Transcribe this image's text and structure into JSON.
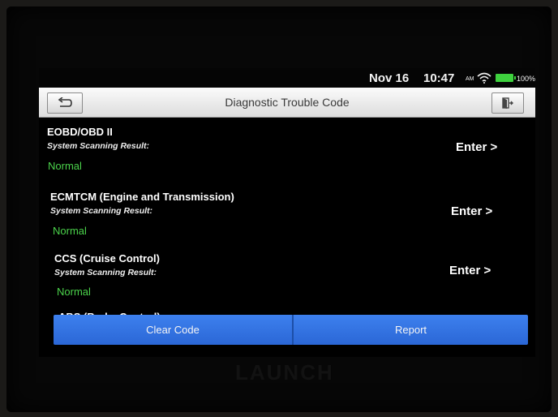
{
  "status": {
    "date": "Nov 16",
    "time": "10:47",
    "ampm": "AM",
    "battery": "100%"
  },
  "header": {
    "title": "Diagnostic Trouble Code"
  },
  "systems": [
    {
      "name": "EOBD/OBD II",
      "label": "System Scanning Result:",
      "status": "Normal",
      "enter": "Enter >"
    },
    {
      "name": "ECMTCM (Engine and Transmission)",
      "label": "System Scanning Result:",
      "status": "Normal",
      "enter": "Enter >"
    },
    {
      "name": "CCS (Cruise Control)",
      "label": "System Scanning Result:",
      "status": "Normal",
      "enter": "Enter >"
    },
    {
      "name": "ABS (Brake Control)"
    }
  ],
  "actions": {
    "clear": "Clear Code",
    "report": "Report"
  },
  "device": {
    "brand": "LAUNCH"
  },
  "colors": {
    "status_ok": "#4bd34b",
    "button": "#3a7ae8"
  }
}
